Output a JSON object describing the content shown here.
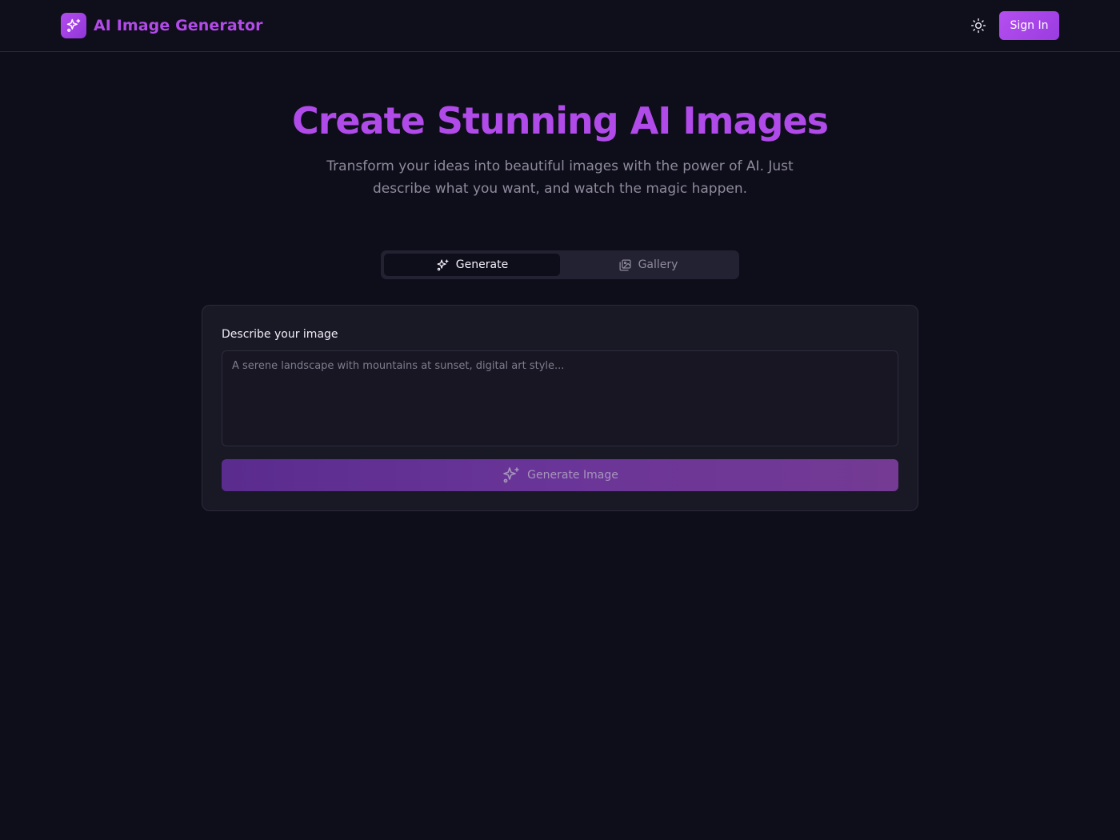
{
  "header": {
    "brand_title": "AI Image Generator",
    "brand_icon": "sparkles-icon",
    "theme_icon": "sun-icon",
    "signin_label": "Sign In"
  },
  "hero": {
    "title": "Create Stunning AI Images",
    "subtitle": "Transform your ideas into beautiful images with the power of AI. Just describe what you want, and watch the magic happen."
  },
  "tabs": [
    {
      "label": "Generate",
      "icon": "sparkles-icon",
      "active": true
    },
    {
      "label": "Gallery",
      "icon": "images-icon",
      "active": false
    }
  ],
  "form": {
    "label": "Describe your image",
    "placeholder": "A serene landscape with mountains at sunset, digital art style...",
    "value": "",
    "button_label": "Generate Image",
    "button_icon": "sparkles-icon"
  },
  "colors": {
    "background": "#0e0d1a",
    "accent": "#b04ae8",
    "card": "#191825"
  }
}
